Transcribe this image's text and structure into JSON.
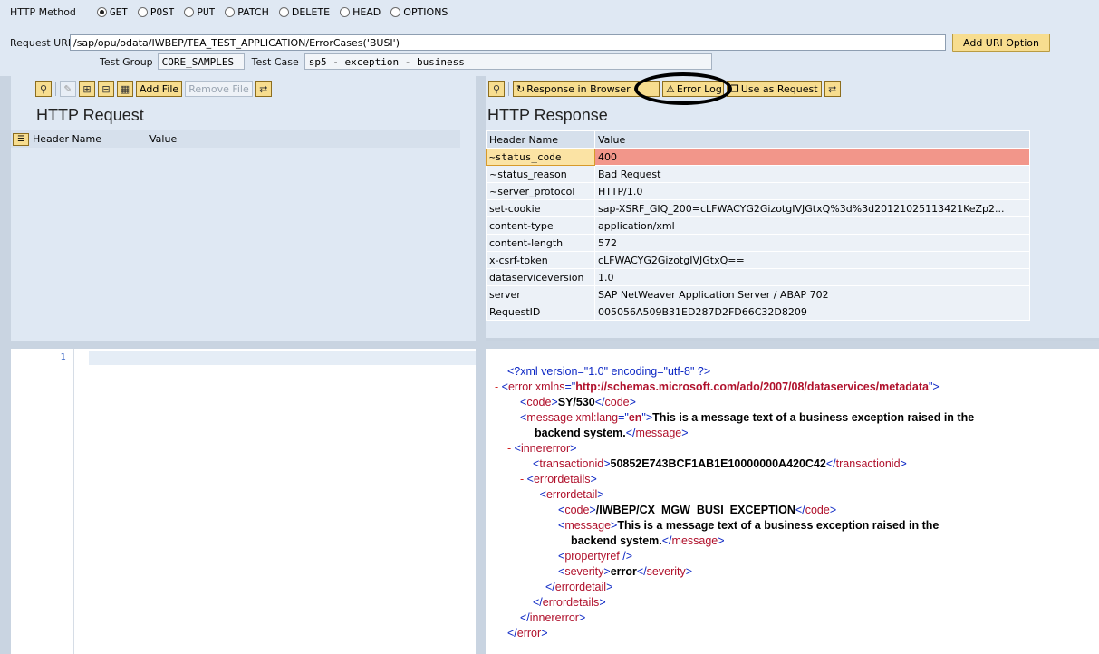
{
  "top": {
    "http_method_label": "HTTP Method",
    "methods": [
      {
        "label": "GET",
        "selected": true
      },
      {
        "label": "POST",
        "selected": false
      },
      {
        "label": "PUT",
        "selected": false
      },
      {
        "label": "PATCH",
        "selected": false
      },
      {
        "label": "DELETE",
        "selected": false
      },
      {
        "label": "HEAD",
        "selected": false
      },
      {
        "label": "OPTIONS",
        "selected": false
      }
    ],
    "request_uri_label": "Request URI",
    "request_uri_value": "/sap/opu/odata/IWBEP/TEA_TEST_APPLICATION/ErrorCases('BUSI')",
    "add_uri_option": "Add URI Option",
    "test_group_label": "Test Group",
    "test_group_value": "CORE_SAMPLES",
    "test_case_label": "Test Case",
    "test_case_value": "sp5 - exception - business"
  },
  "request": {
    "title": "HTTP Request",
    "add_file": "Add File",
    "remove_file": "Remove File",
    "col_header_name": "Header Name",
    "col_value": "Value",
    "line_number": "1"
  },
  "response": {
    "title": "HTTP Response",
    "response_in_browser": "Response in Browser",
    "error_log": "Error Log",
    "use_as_request": "Use as Request",
    "col_header_name": "Header Name",
    "col_value": "Value",
    "headers": [
      {
        "name": "~status_code",
        "value": "400"
      },
      {
        "name": "~status_reason",
        "value": "Bad Request"
      },
      {
        "name": "~server_protocol",
        "value": "HTTP/1.0"
      },
      {
        "name": "set-cookie",
        "value": "sap-XSRF_GIQ_200=cLFWACYG2GizotgIVJGtxQ%3d%3d20121025113421KeZp2..."
      },
      {
        "name": "content-type",
        "value": "application/xml"
      },
      {
        "name": "content-length",
        "value": "572"
      },
      {
        "name": "x-csrf-token",
        "value": "cLFWACYG2GizotgIVJGtxQ=="
      },
      {
        "name": "dataserviceversion",
        "value": "1.0"
      },
      {
        "name": "server",
        "value": "SAP NetWeaver Application Server / ABAP 702"
      },
      {
        "name": "RequestID",
        "value": "005056A509B31ED287D2FD66C32D8209"
      }
    ],
    "highlight_color": "#f2968a"
  },
  "xml": {
    "decl": "<?xml version=\"1.0\" encoding=\"utf-8\" ?>",
    "error_open": "error",
    "xmlns_attr": "xmlns",
    "xmlns_value": "http://schemas.microsoft.com/ado/2007/08/dataservices/metadata",
    "code_value": "SY/530",
    "msg_attr": "xml:lang",
    "msg_lang": "en",
    "msg_text_1": "This is a message text of a business exception raised in the",
    "msg_text_2": "backend system.",
    "transactionid": "50852E743BCF1AB1E10000000A420C42",
    "detail_code": "/IWBEP/CX_MGW_BUSI_EXCEPTION",
    "detail_msg_1": "This is a message text of a business exception raised in the",
    "detail_msg_2": "backend system.",
    "severity": "error"
  }
}
